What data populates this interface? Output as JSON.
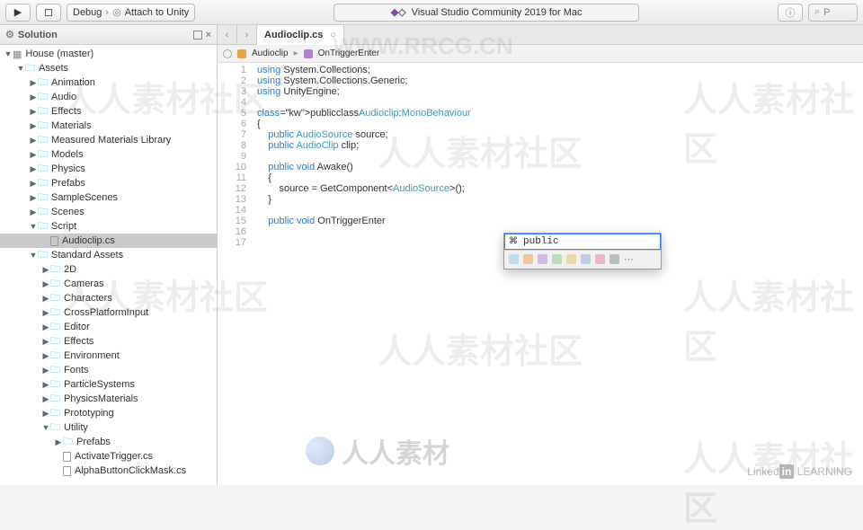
{
  "toolbar": {
    "debug": "Debug",
    "attach": "Attach to Unity",
    "title": "Visual Studio Community 2019 for Mac",
    "search_placeholder": "P"
  },
  "sidebar": {
    "title": "Solution",
    "project": "House (master)",
    "items": [
      {
        "label": "Assets",
        "depth": 1,
        "caret": "down",
        "icon": "folder"
      },
      {
        "label": "Animation",
        "depth": 2,
        "caret": "right",
        "icon": "folder"
      },
      {
        "label": "Audio",
        "depth": 2,
        "caret": "right",
        "icon": "folder"
      },
      {
        "label": "Effects",
        "depth": 2,
        "caret": "right",
        "icon": "folder"
      },
      {
        "label": "Materials",
        "depth": 2,
        "caret": "right",
        "icon": "folder"
      },
      {
        "label": "Measured Materials Library",
        "depth": 2,
        "caret": "right",
        "icon": "folder"
      },
      {
        "label": "Models",
        "depth": 2,
        "caret": "right",
        "icon": "folder"
      },
      {
        "label": "Physics",
        "depth": 2,
        "caret": "right",
        "icon": "folder"
      },
      {
        "label": "Prefabs",
        "depth": 2,
        "caret": "right",
        "icon": "folder"
      },
      {
        "label": "SampleScenes",
        "depth": 2,
        "caret": "right",
        "icon": "folder"
      },
      {
        "label": "Scenes",
        "depth": 2,
        "caret": "right",
        "icon": "folder"
      },
      {
        "label": "Script",
        "depth": 2,
        "caret": "down",
        "icon": "folder"
      },
      {
        "label": "Audioclip.cs",
        "depth": 3,
        "icon": "file",
        "selected": true
      },
      {
        "label": "Standard Assets",
        "depth": 2,
        "caret": "down",
        "icon": "folder"
      },
      {
        "label": "2D",
        "depth": 3,
        "caret": "right",
        "icon": "folder"
      },
      {
        "label": "Cameras",
        "depth": 3,
        "caret": "right",
        "icon": "folder"
      },
      {
        "label": "Characters",
        "depth": 3,
        "caret": "right",
        "icon": "folder"
      },
      {
        "label": "CrossPlatformInput",
        "depth": 3,
        "caret": "right",
        "icon": "folder"
      },
      {
        "label": "Editor",
        "depth": 3,
        "caret": "right",
        "icon": "folder"
      },
      {
        "label": "Effects",
        "depth": 3,
        "caret": "right",
        "icon": "folder"
      },
      {
        "label": "Environment",
        "depth": 3,
        "caret": "right",
        "icon": "folder"
      },
      {
        "label": "Fonts",
        "depth": 3,
        "caret": "right",
        "icon": "folder"
      },
      {
        "label": "ParticleSystems",
        "depth": 3,
        "caret": "right",
        "icon": "folder"
      },
      {
        "label": "PhysicsMaterials",
        "depth": 3,
        "caret": "right",
        "icon": "folder"
      },
      {
        "label": "Prototyping",
        "depth": 3,
        "caret": "right",
        "icon": "folder"
      },
      {
        "label": "Utility",
        "depth": 3,
        "caret": "down",
        "icon": "util"
      },
      {
        "label": "Prefabs",
        "depth": 4,
        "caret": "right",
        "icon": "folder"
      },
      {
        "label": "ActivateTrigger.cs",
        "depth": 4,
        "icon": "file"
      },
      {
        "label": "AlphaButtonClickMask.cs",
        "depth": 4,
        "icon": "file"
      }
    ]
  },
  "tab": {
    "name": "Audioclip.cs"
  },
  "breadcrumb": {
    "type": "Audioclip",
    "method": "OnTriggerEnter",
    "sep": "▸"
  },
  "code": {
    "lines": [
      {
        "n": 1,
        "t": "using System.Collections;",
        "kw": [
          "using"
        ]
      },
      {
        "n": 2,
        "t": "using System.Collections.Generic;",
        "kw": [
          "using"
        ]
      },
      {
        "n": 3,
        "t": "using UnityEngine;",
        "kw": [
          "using"
        ]
      },
      {
        "n": 4,
        "t": ""
      },
      {
        "n": 5,
        "t": "public class Audioclip : MonoBehaviour",
        "kw": [
          "public",
          "class"
        ],
        "tp": [
          "Audioclip",
          "MonoBehaviour"
        ]
      },
      {
        "n": 6,
        "t": "{"
      },
      {
        "n": 7,
        "t": "    public AudioSource source;",
        "kw": [
          "public"
        ],
        "tp": [
          "AudioSource"
        ]
      },
      {
        "n": 8,
        "t": "    public AudioClip clip;",
        "kw": [
          "public"
        ],
        "tp": [
          "AudioClip"
        ]
      },
      {
        "n": 9,
        "t": ""
      },
      {
        "n": 10,
        "t": "    public void Awake()",
        "kw": [
          "public",
          "void"
        ]
      },
      {
        "n": 11,
        "t": "    {"
      },
      {
        "n": 12,
        "t": "        source = GetComponent<AudioSource>();",
        "tp": [
          "AudioSource"
        ]
      },
      {
        "n": 13,
        "t": "    }"
      },
      {
        "n": 14,
        "t": ""
      },
      {
        "n": 15,
        "t": "    public void OnTriggerEnter",
        "kw": [
          "public",
          "void"
        ]
      },
      {
        "n": 16,
        "t": ""
      },
      {
        "n": 17,
        "t": ""
      }
    ]
  },
  "intellisense": {
    "value": "public",
    "filters": [
      "#95c4e8",
      "#e8a247",
      "#b481d1",
      "#86c986",
      "#e0c15a",
      "#8fa8d1",
      "#e0809a",
      "#888"
    ]
  },
  "watermarks": {
    "url": "WWW.RRCG.CN",
    "zh": "人人素材社区",
    "logo": "人人素材",
    "linkedin": "Linked in LEARNING"
  }
}
